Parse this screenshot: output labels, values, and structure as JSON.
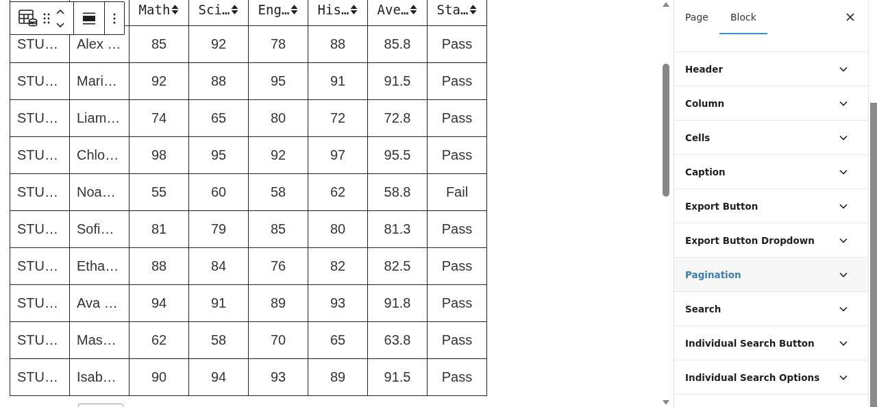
{
  "table": {
    "columns": [
      {
        "kind": "covered"
      },
      {
        "kind": "covered"
      },
      {
        "kind": "sortable",
        "label": "Math"
      },
      {
        "kind": "sortable",
        "label": "Sci…"
      },
      {
        "kind": "sortable",
        "label": "Eng…"
      },
      {
        "kind": "sortable",
        "label": "His…"
      },
      {
        "kind": "sortable",
        "label": "Ave…"
      },
      {
        "kind": "sortable",
        "label": "Sta…"
      }
    ],
    "rows": [
      [
        "STU…",
        "Alex …",
        "85",
        "92",
        "78",
        "88",
        "85.8",
        "Pass"
      ],
      [
        "STU…",
        "Mari…",
        "92",
        "88",
        "95",
        "91",
        "91.5",
        "Pass"
      ],
      [
        "STU…",
        "Liam…",
        "74",
        "65",
        "80",
        "72",
        "72.8",
        "Pass"
      ],
      [
        "STU…",
        "Chlo…",
        "98",
        "95",
        "92",
        "97",
        "95.5",
        "Pass"
      ],
      [
        "STU…",
        "Noa…",
        "55",
        "60",
        "58",
        "62",
        "58.8",
        "Fail"
      ],
      [
        "STU…",
        "Sofi…",
        "81",
        "79",
        "85",
        "80",
        "81.3",
        "Pass"
      ],
      [
        "STU…",
        "Etha…",
        "88",
        "84",
        "76",
        "82",
        "82.5",
        "Pass"
      ],
      [
        "STU…",
        "Ava …",
        "94",
        "91",
        "89",
        "93",
        "91.8",
        "Pass"
      ],
      [
        "STU…",
        "Mas…",
        "62",
        "58",
        "70",
        "65",
        "63.8",
        "Pass"
      ],
      [
        "STU…",
        "Isab…",
        "90",
        "94",
        "93",
        "89",
        "91.5",
        "Pass"
      ]
    ]
  },
  "sidebar": {
    "tabs": [
      {
        "label": "Page",
        "selected": false
      },
      {
        "label": "Block",
        "selected": true
      }
    ],
    "sections": [
      {
        "label": "Header",
        "selected": false
      },
      {
        "label": "Column",
        "selected": false
      },
      {
        "label": "Cells",
        "selected": false
      },
      {
        "label": "Caption",
        "selected": false
      },
      {
        "label": "Export Button",
        "selected": false
      },
      {
        "label": "Export Button Dropdown",
        "selected": false
      },
      {
        "label": "Pagination",
        "selected": true
      },
      {
        "label": "Search",
        "selected": false
      },
      {
        "label": "Individual Search Button",
        "selected": false
      },
      {
        "label": "Individual Search Options",
        "selected": false
      }
    ]
  }
}
